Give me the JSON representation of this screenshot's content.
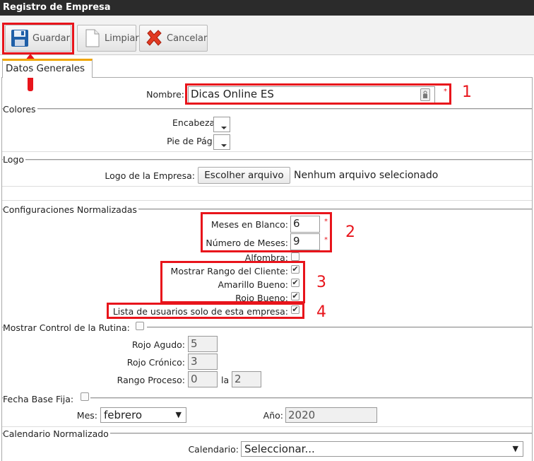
{
  "window": {
    "title": "Registro de Empresa"
  },
  "toolbar": {
    "save_label": "Guardar",
    "clear_label": "Limpiar",
    "cancel_label": "Cancelar"
  },
  "tabs": [
    {
      "label": "Datos Generales"
    }
  ],
  "form": {
    "nombre_label": "Nombre:",
    "nombre_value": "Dicas Online ES",
    "colores_legend": "Colores",
    "encabezado_label": "Encabezado:",
    "pie_label": "Pie de Página:",
    "logo_legend": "Logo",
    "logo_label": "Logo de la Empresa:",
    "file_button": "Escolher arquivo",
    "file_status": "Nenhum arquivo selecionado",
    "config_legend": "Configuraciones Normalizadas",
    "meses_blanco_label": "Meses en Blanco:",
    "meses_blanco_value": "6",
    "numero_meses_label": "Número de Meses:",
    "numero_meses_value": "9",
    "alfombra_label": "Alfombra:",
    "mostrar_rango_label": "Mostrar Rango del Cliente:",
    "amarillo_label": "Amarillo Bueno:",
    "rojo_bueno_label": "Rojo Bueno:",
    "lista_usuarios_label": "Lista de usuarios solo de esta empresa:",
    "rutina_legend": "Mostrar Control de la Rutina:",
    "rojo_agudo_label": "Rojo Agudo:",
    "rojo_agudo_value": "5",
    "rojo_cronico_label": "Rojo Crónico:",
    "rojo_cronico_value": "3",
    "rango_proceso_label": "Rango Proceso:",
    "rango_from": "0",
    "rango_sep": "la",
    "rango_to": "2",
    "fecha_legend": "Fecha Base Fija:",
    "mes_label": "Mes:",
    "mes_value": "febrero",
    "anio_label": "Año:",
    "anio_value": "2020",
    "calendario_legend": "Calendario Normalizado",
    "calendario_label": "Calendario:",
    "calendario_value": "Seleccionar..."
  },
  "annotations": {
    "n1": "1",
    "n2": "2",
    "n3": "3",
    "n4": "4"
  },
  "checkboxes": {
    "alfombra": false,
    "mostrar_rango": true,
    "amarillo": true,
    "rojo_bueno": true,
    "lista_usuarios": true,
    "rutina": false,
    "fecha": false
  },
  "colors": {
    "annotation_red": "#e8141b",
    "titlebar": "#2b2b2b",
    "tab_accent": "#f0a500"
  }
}
